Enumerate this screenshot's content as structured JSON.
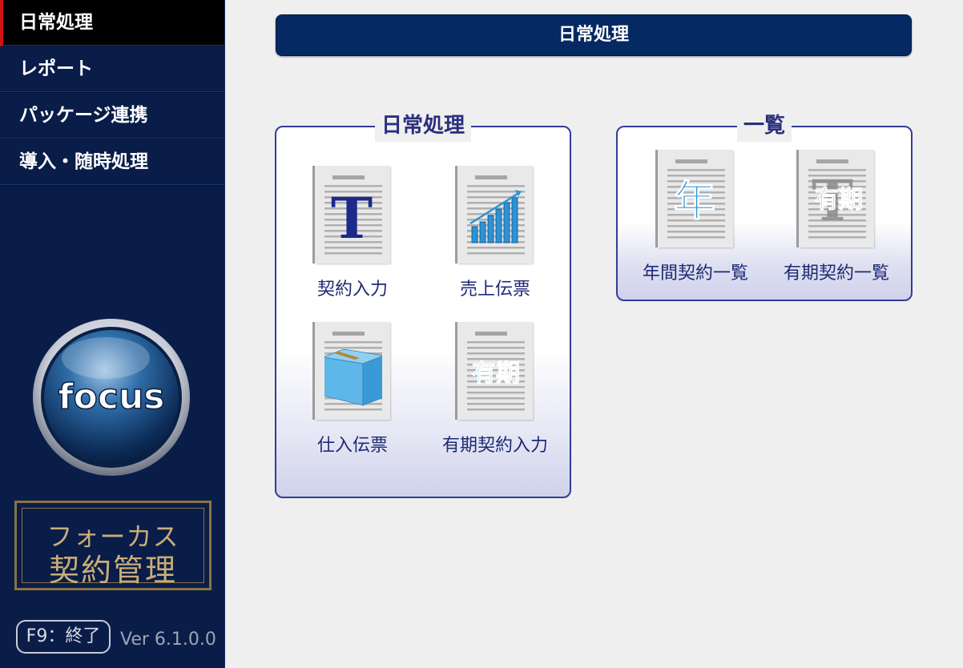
{
  "sidebar": {
    "items": [
      {
        "label": "日常処理",
        "active": true
      },
      {
        "label": "レポート"
      },
      {
        "label": "パッケージ連携"
      },
      {
        "label": "導入・随時処理"
      }
    ],
    "logo_text": "focus",
    "brand_line1": "フォーカス",
    "brand_line2": "契約管理",
    "exit_button": "F9：終了",
    "version": "Ver 6.1.0.0"
  },
  "header": {
    "title": "日常処理"
  },
  "panels": [
    {
      "title": "日常処理",
      "tiles": [
        {
          "label": "契約入力",
          "icon": "letter-t-document-icon",
          "icon_text": "T"
        },
        {
          "label": "売上伝票",
          "icon": "bar-chart-document-icon"
        },
        {
          "label": "仕入伝票",
          "icon": "box-document-icon"
        },
        {
          "label": "有期契約入力",
          "icon": "fixed-term-document-icon",
          "icon_text": "有期"
        }
      ]
    },
    {
      "title": "一覧",
      "tiles": [
        {
          "label": "年間契約一覧",
          "icon": "annual-document-icon",
          "icon_text": "年"
        },
        {
          "label": "有期契約一覧",
          "icon": "fixed-term-list-document-icon",
          "icon_text": "有期"
        }
      ]
    }
  ],
  "colors": {
    "sidebar_bg": "#0a1d49",
    "header_bg": "#052962",
    "accent_red": "#d01218",
    "panel_border": "#323d96"
  }
}
